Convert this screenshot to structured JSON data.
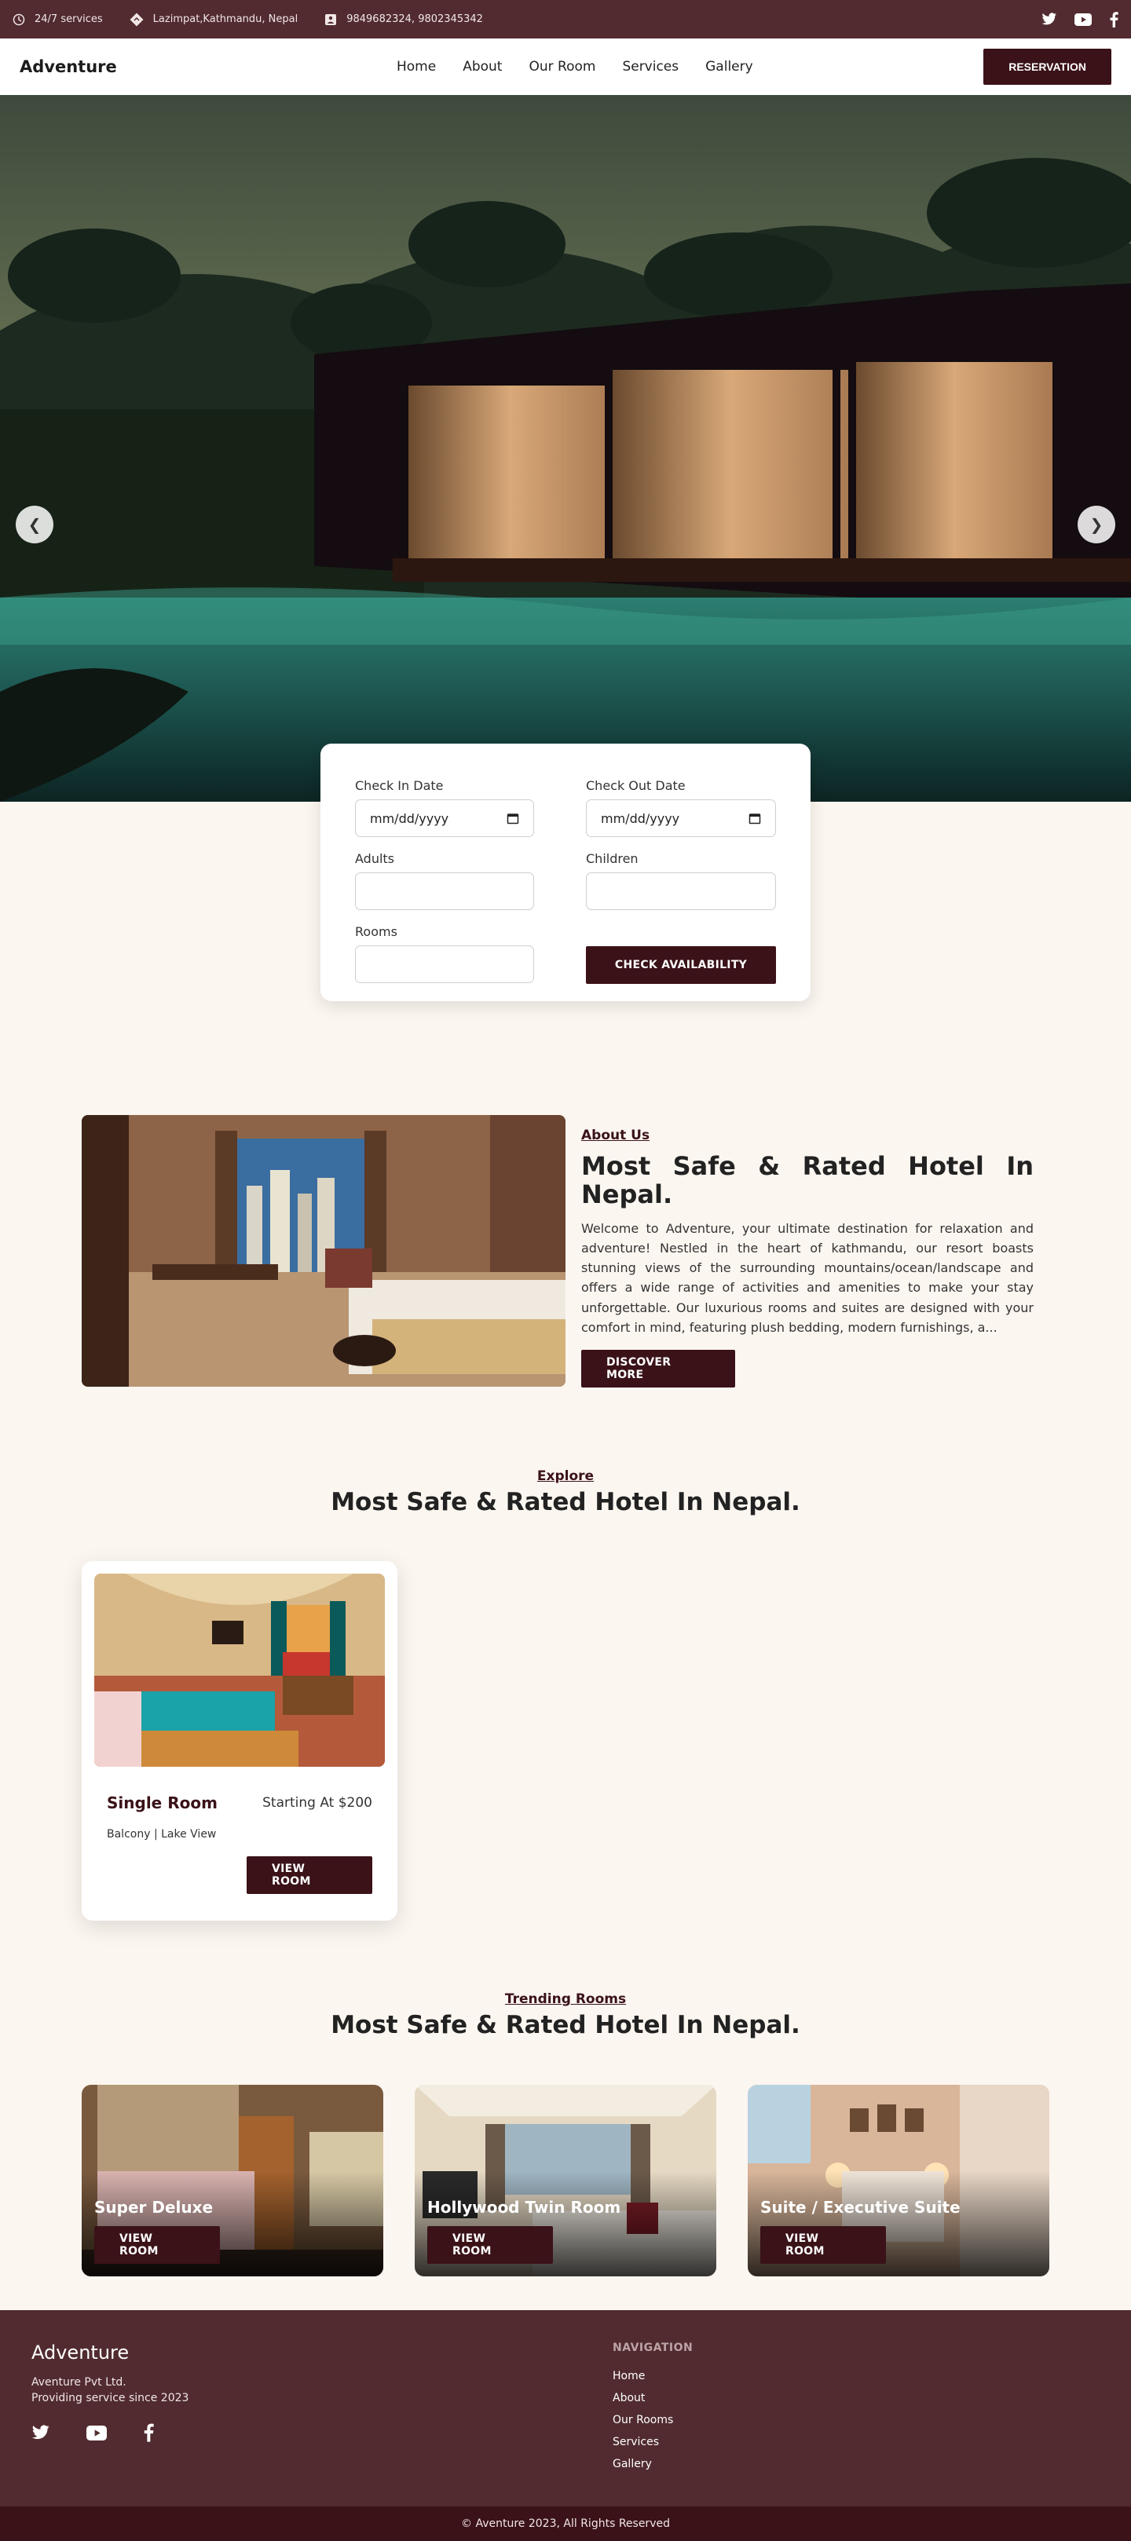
{
  "topbar": {
    "service": "24/7 services",
    "address": "Lazimpat,Kathmandu, Nepal",
    "phone": "9849682324, 9802345342"
  },
  "nav": {
    "brand": "Adventure",
    "links": [
      "Home",
      "About",
      "Our Room",
      "Services",
      "Gallery"
    ],
    "reservation": "RESERVATION"
  },
  "booking": {
    "checkin_label": "Check In Date",
    "checkin_placeholder": "mm/dd/yyyy",
    "checkout_label": "Check Out Date",
    "checkout_placeholder": "mm/dd/yyyy",
    "adults_label": "Adults",
    "children_label": "Children",
    "rooms_label": "Rooms",
    "check_button": "CHECK AVAILABILITY"
  },
  "about": {
    "eyebrow": "About Us",
    "title": "Most Safe & Rated Hotel In Nepal.",
    "body": "Welcome to Adventure, your ultimate destination for relaxation and adventure! Nestled in the heart of kathmandu, our resort boasts stunning views of the surrounding mountains/ocean/landscape and offers a wide range of activities and amenities to make your stay unforgettable. Our luxurious rooms and suites are designed with your comfort in mind, featuring plush bedding, modern furnishings, a...",
    "button": "DISCOVER MORE"
  },
  "explore": {
    "eyebrow": "Explore",
    "title": "Most Safe & Rated Hotel In Nepal.",
    "room": {
      "name": "Single Room",
      "price": "Starting At $200",
      "features": "Balcony | Lake View",
      "button": "VIEW ROOM"
    }
  },
  "trending": {
    "eyebrow": "Trending Rooms",
    "title": "Most Safe & Rated Hotel In Nepal.",
    "rooms": [
      {
        "name": "Super Deluxe",
        "button": "VIEW ROOM"
      },
      {
        "name": "Hollywood Twin Room",
        "button": "VIEW ROOM"
      },
      {
        "name": "Suite / Executive Suite",
        "button": "VIEW ROOM"
      }
    ]
  },
  "footer": {
    "brand": "Adventure",
    "company": "Aventure Pvt Ltd.",
    "since": "Providing service since 2023",
    "nav_heading": "NAVIGATION",
    "nav_links": [
      "Home",
      "About",
      "Our Rooms",
      "Services",
      "Gallery"
    ],
    "copyright": "© Aventure 2023, All Rights Reserved"
  },
  "colors": {
    "maroon": "#512b2f",
    "dark_maroon": "#3a1218",
    "background": "#fcf6f0"
  },
  "icons": [
    "clock-icon",
    "location-icon",
    "phone-icon",
    "twitter-icon",
    "youtube-icon",
    "facebook-icon",
    "calendar-icon",
    "chevron-left-icon",
    "chevron-right-icon"
  ]
}
